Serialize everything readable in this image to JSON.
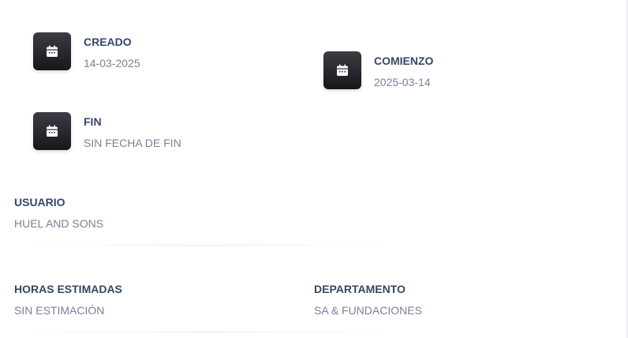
{
  "dates": {
    "created": {
      "label": "CREADO",
      "value": "14-03-2025",
      "icon": "calendar-icon"
    },
    "start": {
      "label": "COMIENZO",
      "value": "2025-03-14",
      "icon": "calendar-icon"
    },
    "end": {
      "label": "FIN",
      "value": "SIN FECHA DE FIN",
      "icon": "calendar-icon"
    }
  },
  "user": {
    "label": "USUARIO",
    "value": "HUEL AND SONS"
  },
  "estimated_hours": {
    "label": "HORAS ESTIMADAS",
    "value": "SIN ESTIMACIÓN"
  },
  "department": {
    "label": "DEPARTAMENTO",
    "value": "SA & FUNDACIONES"
  },
  "colors": {
    "label": "#344767",
    "value": "#7b809a",
    "icon_bg_top": "#3c3c44",
    "icon_bg_bottom": "#17171b"
  }
}
